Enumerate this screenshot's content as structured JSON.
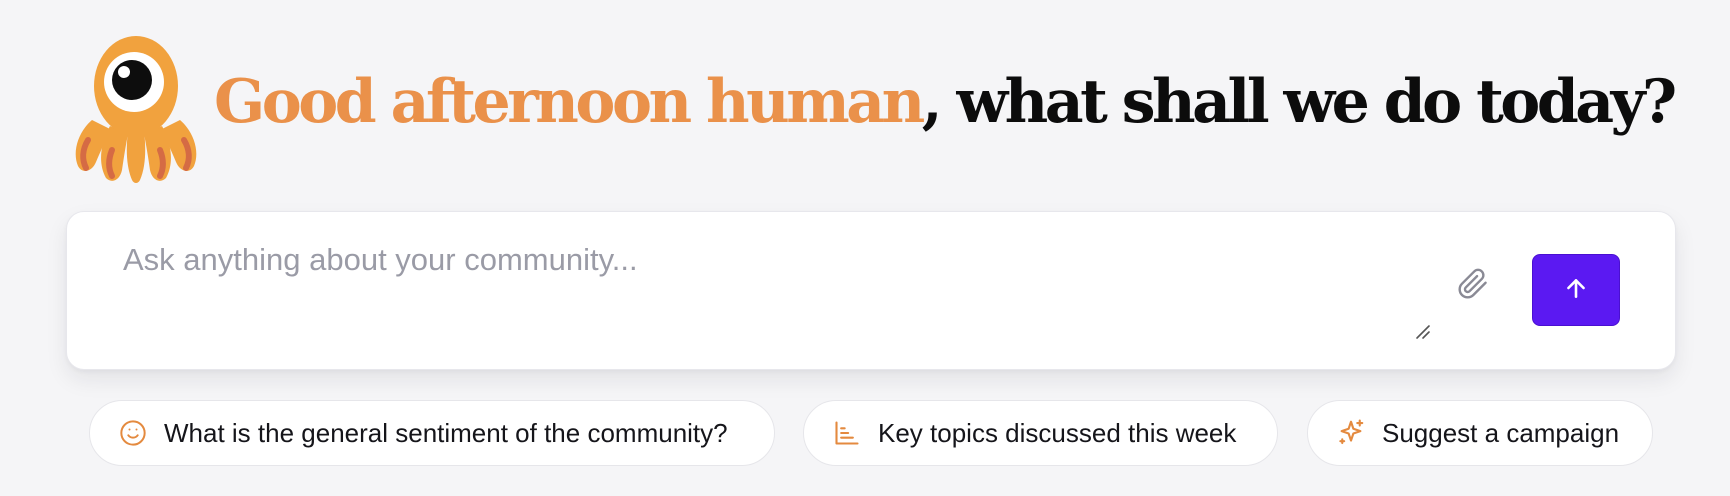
{
  "header": {
    "mascot_icon": "octopus-mascot-icon",
    "greeting_highlight": "Good afternoon human",
    "greeting_rest": ", what shall we do today?",
    "highlight_color": "#ea914a"
  },
  "prompt": {
    "placeholder": "Ask anything about your community...",
    "value": "",
    "attach_icon": "paperclip-icon",
    "send_icon": "arrow-up-icon",
    "send_color": "#5b19f2"
  },
  "suggestions": [
    {
      "icon": "smile-icon",
      "label": "What is the general sentiment of the community?"
    },
    {
      "icon": "bar-chart-icon",
      "label": "Key topics discussed this week"
    },
    {
      "icon": "sparkles-icon",
      "label": "Suggest a campaign"
    }
  ]
}
